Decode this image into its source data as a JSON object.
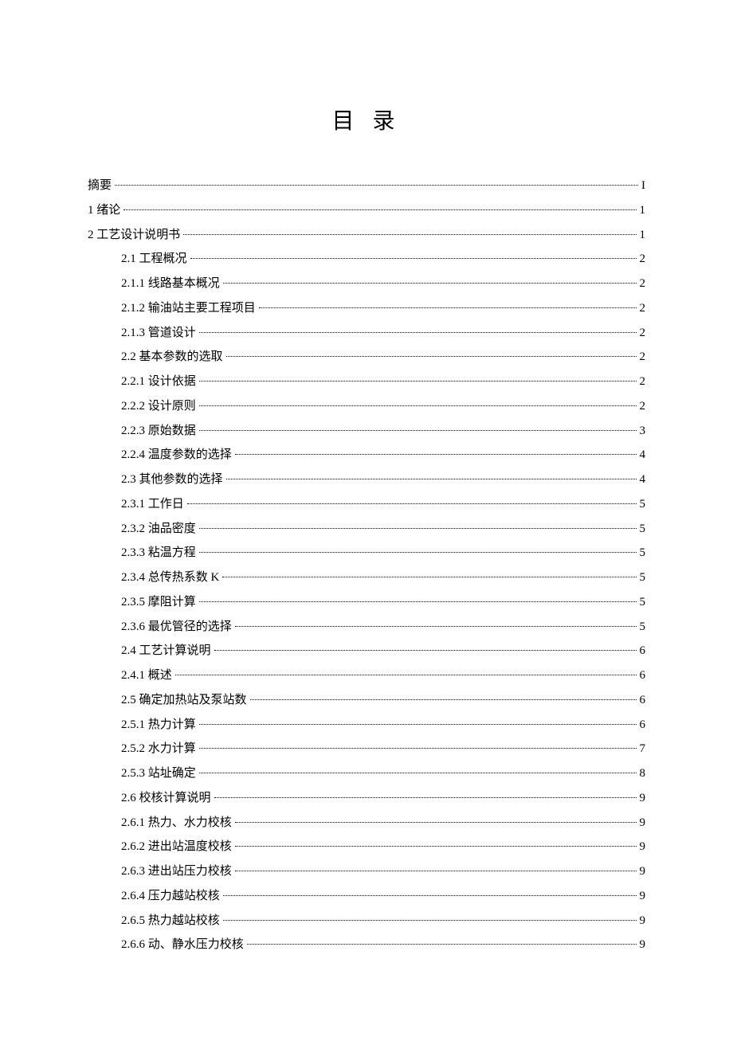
{
  "title": "目 录",
  "entries": [
    {
      "level": 0,
      "label": "摘要",
      "page": "I"
    },
    {
      "level": 0,
      "label": "1 绪论",
      "page": "1"
    },
    {
      "level": 0,
      "label": "2 工艺设计说明书",
      "page": "1"
    },
    {
      "level": 1,
      "label": "2.1 工程概况",
      "page": "2"
    },
    {
      "level": 1,
      "label": "2.1.1 线路基本概况",
      "page": "2"
    },
    {
      "level": 1,
      "label": "2.1.2 输油站主要工程项目",
      "page": "2"
    },
    {
      "level": 1,
      "label": "2.1.3 管道设计",
      "page": "2"
    },
    {
      "level": 1,
      "label": "2.2 基本参数的选取",
      "page": "2"
    },
    {
      "level": 1,
      "label": "2.2.1 设计依据",
      "page": "2"
    },
    {
      "level": 1,
      "label": "2.2.2 设计原则",
      "page": "2"
    },
    {
      "level": 1,
      "label": "2.2.3 原始数据",
      "page": "3"
    },
    {
      "level": 1,
      "label": "2.2.4 温度参数的选择",
      "page": "4"
    },
    {
      "level": 1,
      "label": "2.3 其他参数的选择",
      "page": "4"
    },
    {
      "level": 1,
      "label": "2.3.1 工作日",
      "page": "5"
    },
    {
      "level": 1,
      "label": "2.3.2 油品密度",
      "page": "5"
    },
    {
      "level": 1,
      "label": "2.3.3 粘温方程",
      "page": "5"
    },
    {
      "level": 1,
      "label": "2.3.4 总传热系数 K",
      "page": "5"
    },
    {
      "level": 1,
      "label": "2.3.5 摩阻计算",
      "page": "5"
    },
    {
      "level": 1,
      "label": "2.3.6 最优管径的选择",
      "page": "5"
    },
    {
      "level": 1,
      "label": "2.4 工艺计算说明",
      "page": "6"
    },
    {
      "level": 1,
      "label": "2.4.1 概述",
      "page": "6"
    },
    {
      "level": 1,
      "label": "2.5 确定加热站及泵站数",
      "page": "6"
    },
    {
      "level": 1,
      "label": "2.5.1 热力计算",
      "page": "6"
    },
    {
      "level": 1,
      "label": "2.5.2 水力计算",
      "page": "7"
    },
    {
      "level": 1,
      "label": "2.5.3 站址确定",
      "page": "8"
    },
    {
      "level": 1,
      "label": "2.6 校核计算说明",
      "page": "9"
    },
    {
      "level": 1,
      "label": "2.6.1 热力、水力校核",
      "page": "9"
    },
    {
      "level": 1,
      "label": "2.6.2 进出站温度校核",
      "page": "9"
    },
    {
      "level": 1,
      "label": "2.6.3 进出站压力校核",
      "page": "9"
    },
    {
      "level": 1,
      "label": "2.6.4 压力越站校核",
      "page": "9"
    },
    {
      "level": 1,
      "label": "2.6.5 热力越站校核",
      "page": "9"
    },
    {
      "level": 1,
      "label": "2.6.6 动、静水压力校核",
      "page": "9"
    }
  ]
}
